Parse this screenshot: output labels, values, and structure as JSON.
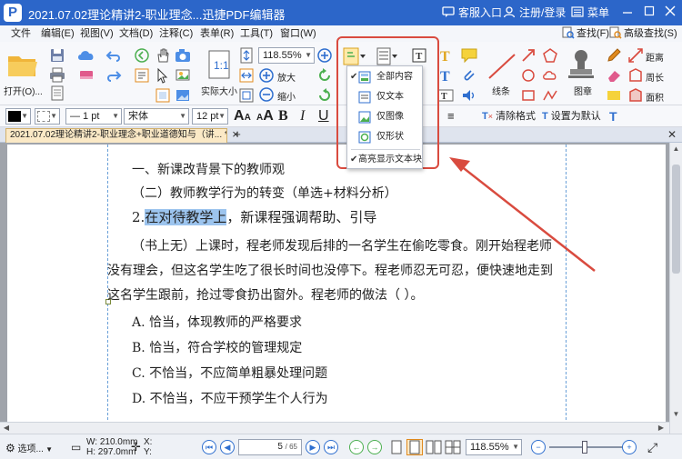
{
  "app": {
    "logo": "P",
    "title": "2021.07.02理论精讲2-职业理念...迅捷PDF编辑器",
    "support": "客服入口",
    "login": "注册/登录",
    "menu": "菜单"
  },
  "menubar": {
    "items": [
      "文件",
      "编辑(E)",
      "视图(V)",
      "文档(D)",
      "注释(C)",
      "表单(R)",
      "工具(T)",
      "窗口(W)"
    ],
    "find": "查找(F)",
    "advanced_find": "高级查找(S)"
  },
  "ribbon": {
    "open_label": "打开(O)...",
    "actual_size": "实际大小",
    "zoom_value": "118.55%",
    "zoom_in": "放大",
    "zoom_out": "缩小",
    "line_label": "线条",
    "stamp_label": "图章",
    "distance": "距离",
    "perimeter": "周长",
    "area": "面积"
  },
  "formatbar": {
    "line_width": "— 1 pt",
    "font": "宋体",
    "font_size": "12 pt",
    "clear_format": "清除格式",
    "set_default": "设置为默认"
  },
  "tab": {
    "label": "2021.07.02理论精讲2-职业理念+职业道德知与（讲... *"
  },
  "dropdown": {
    "items": [
      {
        "label": "全部内容",
        "checked": true
      },
      {
        "label": "仅文本",
        "checked": false
      },
      {
        "label": "仅图像",
        "checked": false
      },
      {
        "label": "仅形状",
        "checked": false
      }
    ],
    "highlight": {
      "label": "高亮显示文本块",
      "checked": true
    }
  },
  "document": {
    "heading": "一、新课改背景下的教师观",
    "subheading": "（二）教师教学行为的转变（单选+材料分析）",
    "item_num": "2.",
    "item_highlight": "在对待教学上",
    "item_rest": "，新课程强调帮助、引导",
    "para": [
      "（书上无）上课时，程老师发现后排的一名学生在偷吃零食。刚开始程老师",
      "没有理会，但这名学生吃了很长时间也没停下。程老师忍无可忍，便快速地走到",
      "这名学生跟前，抢过零食扔出窗外。程老师的做法（    ）。"
    ],
    "options": [
      "A. 恰当，体现教师的严格要求",
      "B. 恰当，符合学校的管理规定",
      "C. 不恰当，不应简单粗暴处理问题",
      "D. 不恰当，不应干预学生个人行为"
    ]
  },
  "statusbar": {
    "options": "选项...",
    "width": "W: 210.0mm",
    "height": "H: 297.0mm",
    "x": "X:",
    "y": "Y:",
    "page_current": "5",
    "page_total": "/ 65",
    "zoom": "118.55%"
  },
  "colors": {
    "titlebar": "#2c66c9",
    "highlight": "#9cc4ee",
    "annotation_red": "#d94b3f",
    "tab_bg": "#fbe9c6"
  }
}
